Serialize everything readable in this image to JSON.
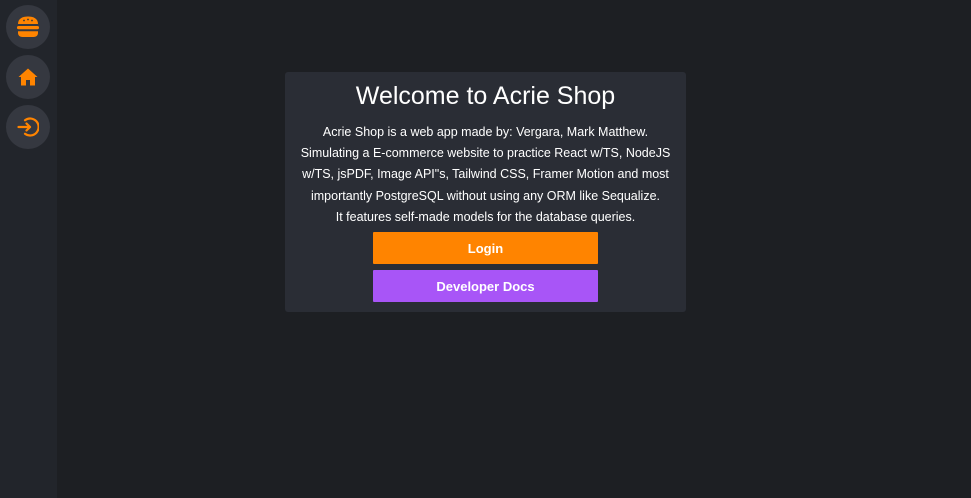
{
  "colors": {
    "background": "#1d1f23",
    "sidebar": "#22252b",
    "card": "#2a2d35",
    "accent_orange": "#ff8400",
    "accent_purple": "#a855f7"
  },
  "sidebar": {
    "items": [
      {
        "icon": "burger-icon"
      },
      {
        "icon": "home-icon"
      },
      {
        "icon": "login-arrow-icon"
      }
    ]
  },
  "welcome": {
    "title": "Welcome to Acrie Shop",
    "description_lines": [
      "Acrie Shop is a web app made by: Vergara, Mark Matthew.",
      "Simulating a E-commerce website to practice React w/TS, NodeJS",
      "w/TS, jsPDF, Image API\"s, Tailwind CSS, Framer Motion and most",
      "importantly PostgreSQL without using any ORM like Sequalize.",
      "It features self-made models for the database queries."
    ],
    "login_label": "Login",
    "docs_label": "Developer Docs"
  }
}
